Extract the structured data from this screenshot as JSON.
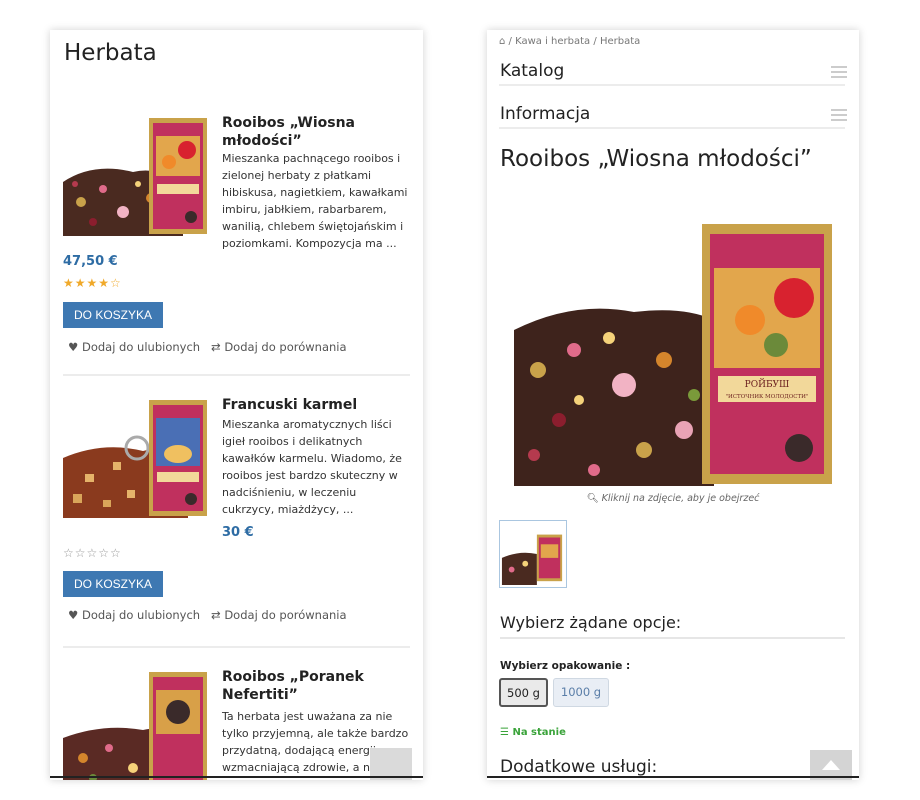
{
  "left": {
    "heading": "Herbata",
    "products": [
      {
        "title": "Rooibos „Wiosna młodości”",
        "description": "Mieszanka pachnącego rooibos i zielonej herbaty z płatkami hibiskusa, nagietkiem, kawałkami imbiru, jabłkiem, rabarbarem, wanilią, chlebem świętojańskim i poziomkami. Kompozycja ma ...",
        "price": "47,50 €",
        "rating": "★★★★☆",
        "cart_label": "DO KOSZYKA",
        "wishlist_label": "Dodaj do ulubionych",
        "compare_label": "Dodaj do porównania"
      },
      {
        "title": "Francuski karmel",
        "description": "Mieszanka aromatycznych liści igieł rooibos i delikatnych kawałków karmelu. Wiadomo, że rooibos jest bardzo skuteczny w nadciśnieniu, w leczeniu cukrzycy, miażdżycy, ...",
        "price": "30 €",
        "rating": "☆☆☆☆☆",
        "cart_label": "DO KOSZYKA",
        "wishlist_label": "Dodaj do ulubionych",
        "compare_label": "Dodaj do porównania"
      },
      {
        "title": "Rooibos „Poranek Nefertiti”",
        "description": "Ta herbata jest uważana za nie tylko przyjemną, ale także bardzo przydatną, dodającą energii, wzmacniającą zdrowie, a nawet"
      }
    ]
  },
  "right": {
    "breadcrumb": [
      "Kawa i herbata",
      "Herbata"
    ],
    "breadcrumb_sep": "/",
    "accordion": [
      "Katalog",
      "Informacja"
    ],
    "product_title": "Rooibos „Wiosna młodości”",
    "zoom_hint": "Kliknij na zdjęcie, aby je obejrzeć",
    "package_text_1": "РОЙБУШ",
    "package_text_2": "\"ИСТОЧНИК МОЛОДОСТИ\"",
    "options_heading": "Wybierz żądane opcje:",
    "packaging_label": "Wybierz opakowanie :",
    "packaging_options": [
      "500 g",
      "1000 g"
    ],
    "selected_option": "500 g",
    "stock_label": "Na stanie",
    "additional_heading": "Dodatkowe usługi:"
  },
  "colors": {
    "accent_blue": "#3e78b2",
    "price_blue": "#2e6ca4",
    "star_gold": "#f0a92a",
    "in_stock_green": "#3aa33a"
  }
}
